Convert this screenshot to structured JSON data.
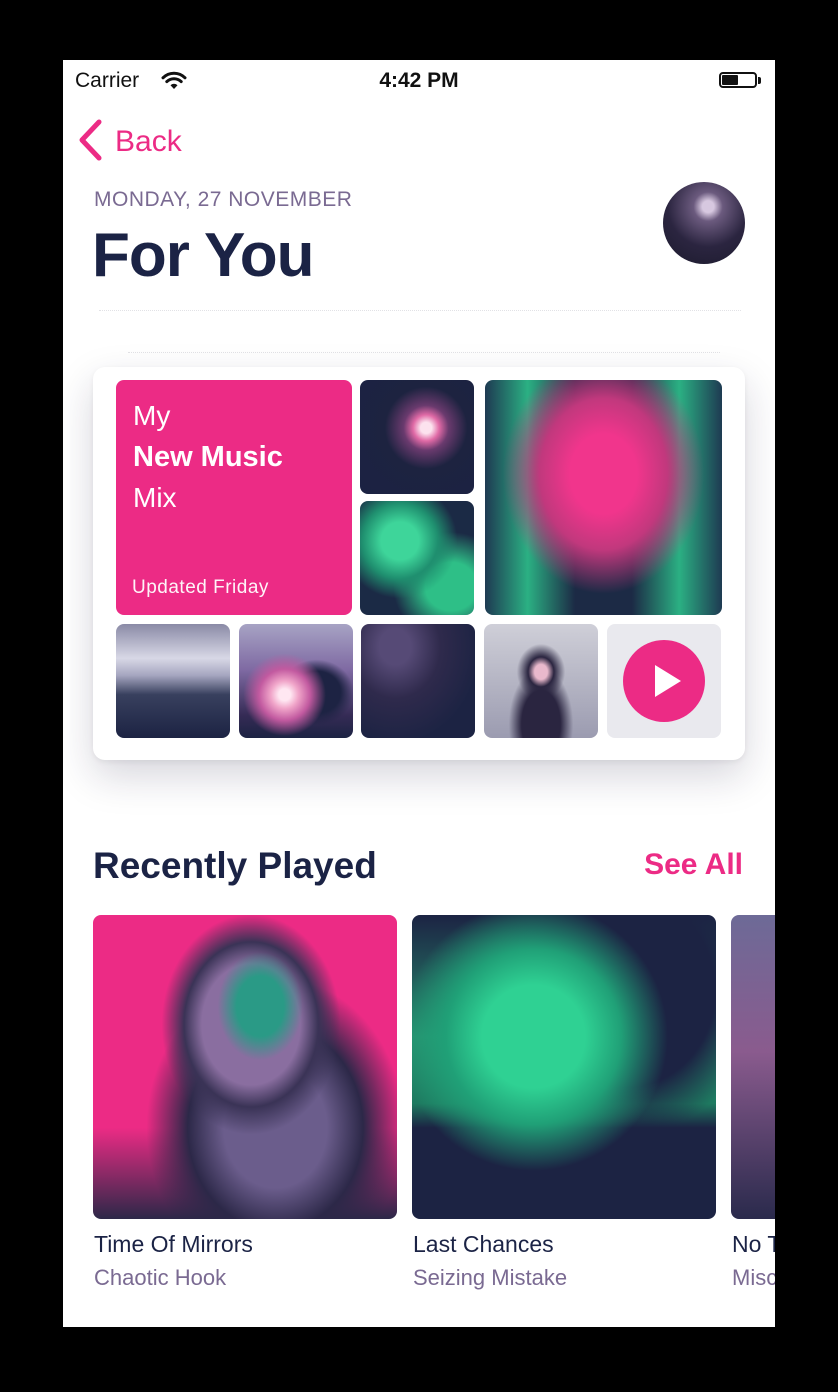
{
  "status_bar": {
    "carrier": "Carrier",
    "time": "4:42 PM"
  },
  "nav": {
    "back_label": "Back"
  },
  "header": {
    "date": "MONDAY, 27 NOVEMBER",
    "title": "For You"
  },
  "mix_card": {
    "line1": "My",
    "line2": "New Music",
    "line3": "Mix",
    "updated": "Updated Friday"
  },
  "recently_played": {
    "title": "Recently Played",
    "see_all": "See All",
    "albums": [
      {
        "name": "Time Of Mirrors",
        "artist": "Chaotic Hook"
      },
      {
        "name": "Last Chances",
        "artist": "Seizing Mistake"
      },
      {
        "name": "No T",
        "artist": "Misc"
      }
    ]
  },
  "colors": {
    "accent": "#ec2b85",
    "title": "#1b2345",
    "secondary": "#7a6a92"
  },
  "icons": {
    "back": "chevron-left-icon",
    "wifi": "wifi-icon",
    "battery": "battery-icon",
    "play": "play-icon"
  }
}
